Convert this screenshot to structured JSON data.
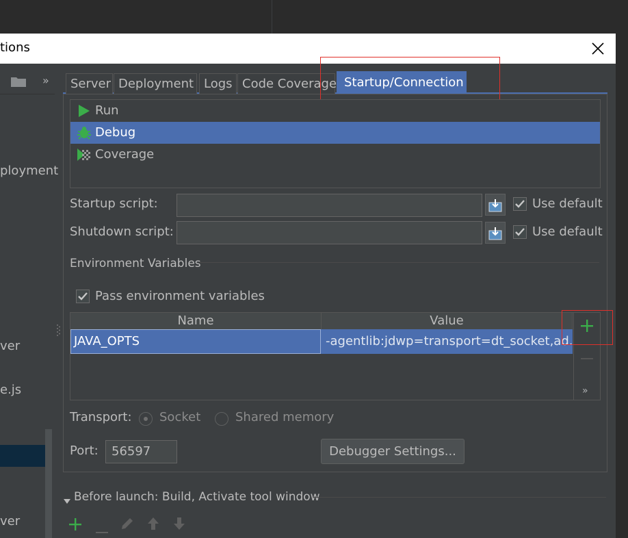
{
  "window": {
    "title_fragment": "tions"
  },
  "left_panel": {
    "more_glyph": "»",
    "items": [
      "ployment",
      "ver",
      "e.js",
      "ver"
    ]
  },
  "tabs": [
    {
      "label": "Server"
    },
    {
      "label": "Deployment"
    },
    {
      "label": "Logs"
    },
    {
      "label": "Code Coverage"
    },
    {
      "label": "Startup/Connection",
      "active": true
    }
  ],
  "executors": [
    {
      "label": "Run",
      "icon": "run-icon"
    },
    {
      "label": "Debug",
      "icon": "debug-icon",
      "selected": true
    },
    {
      "label": "Coverage",
      "icon": "coverage-icon"
    }
  ],
  "startup": {
    "label": "Startup script:",
    "value": "",
    "use_default_label": "Use default",
    "use_default_checked": true
  },
  "shutdown": {
    "label": "Shutdown script:",
    "value": "",
    "use_default_label": "Use default",
    "use_default_checked": true
  },
  "env": {
    "section_title": "Environment Variables",
    "pass_label": "Pass environment variables",
    "pass_checked": true,
    "columns": [
      "Name",
      "Value"
    ],
    "rows": [
      {
        "name": "JAVA_OPTS",
        "value": "-agentlib:jdwp=transport=dt_socket,ad..."
      }
    ],
    "more_glyph": "»"
  },
  "transport": {
    "label": "Transport:",
    "options": [
      {
        "label": "Socket",
        "selected": true
      },
      {
        "label": "Shared memory",
        "selected": false
      }
    ]
  },
  "port": {
    "label": "Port:",
    "value": "56597"
  },
  "debugger_settings_label": "Debugger Settings...",
  "before_launch": {
    "label": "Before launch: Build, Activate tool window"
  },
  "colors": {
    "selection": "#4b6eaf",
    "add_green": "#3bad4a",
    "highlight_red": "#e0302a"
  }
}
